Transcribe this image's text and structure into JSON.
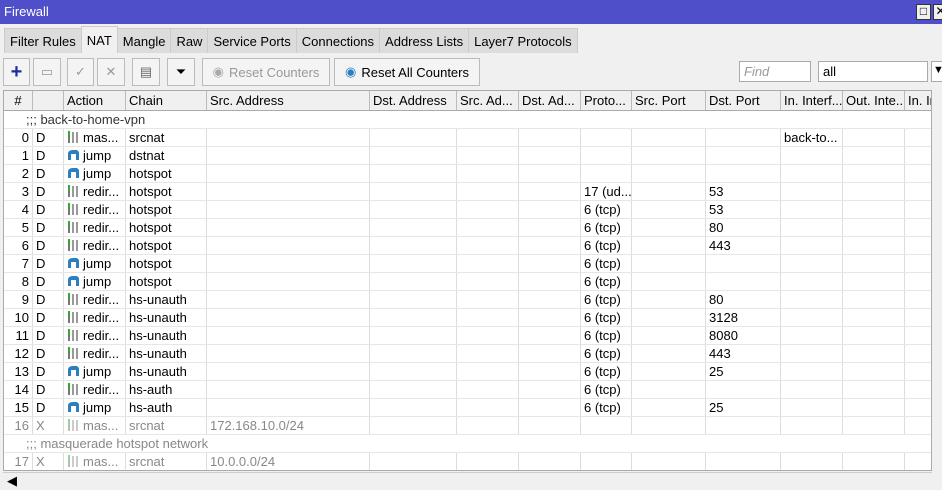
{
  "window": {
    "title": "Firewall"
  },
  "tabs": [
    "Filter Rules",
    "NAT",
    "Mangle",
    "Raw",
    "Service Ports",
    "Connections",
    "Address Lists",
    "Layer7 Protocols"
  ],
  "active_tab": "NAT",
  "toolbar": {
    "reset_counters": "Reset Counters",
    "reset_all_counters": "Reset All Counters",
    "find_placeholder": "Find",
    "filter_value": "all"
  },
  "columns": [
    "#",
    "",
    "Action",
    "Chain",
    "Src. Address",
    "Dst. Address",
    "Src. Ad...",
    "Dst. Ad...",
    "Proto...",
    "Src. Port",
    "Dst. Port",
    "In. Interf...",
    "Out. Inte...",
    "In. In"
  ],
  "rows": [
    {
      "comment": ";;; back-to-home-vpn"
    },
    {
      "num": "0",
      "flag": "D",
      "action": "mas...",
      "icon": "masquerade",
      "chain": "srcnat",
      "src": "",
      "proto": "",
      "dport": "",
      "inif": "back-to..."
    },
    {
      "num": "1",
      "flag": "D",
      "action": "jump",
      "icon": "jump",
      "chain": "dstnat"
    },
    {
      "num": "2",
      "flag": "D",
      "action": "jump",
      "icon": "jump",
      "chain": "hotspot"
    },
    {
      "num": "3",
      "flag": "D",
      "action": "redir...",
      "icon": "redirect",
      "chain": "hotspot",
      "proto": "17 (ud...",
      "dport": "53"
    },
    {
      "num": "4",
      "flag": "D",
      "action": "redir...",
      "icon": "redirect",
      "chain": "hotspot",
      "proto": "6 (tcp)",
      "dport": "53"
    },
    {
      "num": "5",
      "flag": "D",
      "action": "redir...",
      "icon": "redirect",
      "chain": "hotspot",
      "proto": "6 (tcp)",
      "dport": "80"
    },
    {
      "num": "6",
      "flag": "D",
      "action": "redir...",
      "icon": "redirect",
      "chain": "hotspot",
      "proto": "6 (tcp)",
      "dport": "443"
    },
    {
      "num": "7",
      "flag": "D",
      "action": "jump",
      "icon": "jump",
      "chain": "hotspot",
      "proto": "6 (tcp)"
    },
    {
      "num": "8",
      "flag": "D",
      "action": "jump",
      "icon": "jump",
      "chain": "hotspot",
      "proto": "6 (tcp)"
    },
    {
      "num": "9",
      "flag": "D",
      "action": "redir...",
      "icon": "redirect",
      "chain": "hs-unauth",
      "proto": "6 (tcp)",
      "dport": "80"
    },
    {
      "num": "10",
      "flag": "D",
      "action": "redir...",
      "icon": "redirect",
      "chain": "hs-unauth",
      "proto": "6 (tcp)",
      "dport": "3128"
    },
    {
      "num": "11",
      "flag": "D",
      "action": "redir...",
      "icon": "redirect",
      "chain": "hs-unauth",
      "proto": "6 (tcp)",
      "dport": "8080"
    },
    {
      "num": "12",
      "flag": "D",
      "action": "redir...",
      "icon": "redirect",
      "chain": "hs-unauth",
      "proto": "6 (tcp)",
      "dport": "443"
    },
    {
      "num": "13",
      "flag": "D",
      "action": "jump",
      "icon": "jump",
      "chain": "hs-unauth",
      "proto": "6 (tcp)",
      "dport": "25"
    },
    {
      "num": "14",
      "flag": "D",
      "action": "redir...",
      "icon": "redirect",
      "chain": "hs-auth",
      "proto": "6 (tcp)"
    },
    {
      "num": "15",
      "flag": "D",
      "action": "jump",
      "icon": "jump",
      "chain": "hs-auth",
      "proto": "6 (tcp)",
      "dport": "25"
    },
    {
      "num": "16",
      "flag": "X",
      "action": "mas...",
      "icon": "masquerade",
      "chain": "srcnat",
      "src": "172.168.10.0/24",
      "disabled": true
    },
    {
      "comment": ";;; masquerade hotspot network",
      "disabled": true
    },
    {
      "num": "17",
      "flag": "X",
      "action": "mas...",
      "icon": "masquerade",
      "chain": "srcnat",
      "src": "10.0.0.0/24",
      "disabled": true
    }
  ],
  "colors": {
    "titlebar": "#4f4fc9",
    "add": "#1a2fa0",
    "jump": "#2a7fc0"
  }
}
